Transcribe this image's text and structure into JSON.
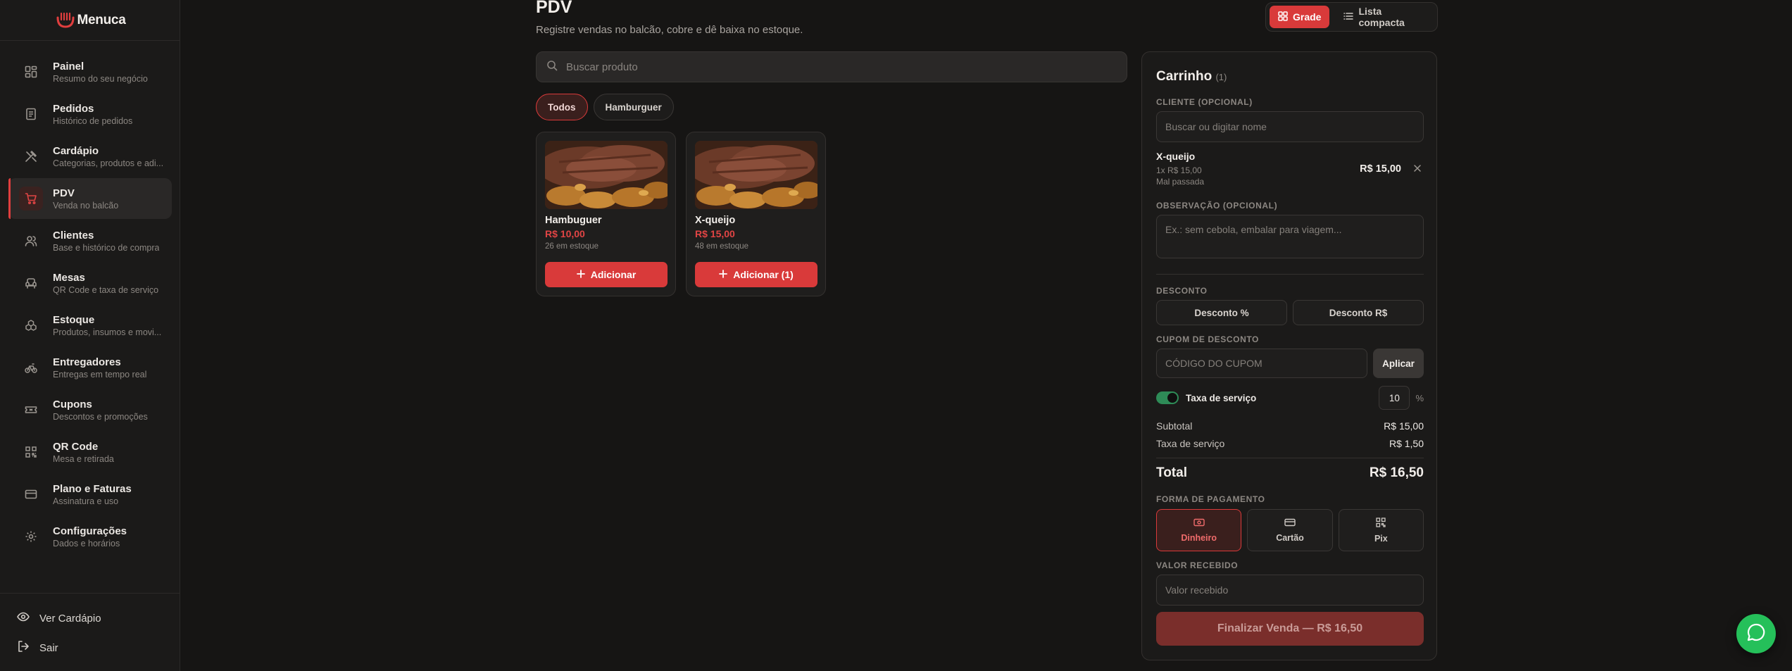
{
  "brand": {
    "name": "Menuca",
    "accent": "#d93a3a"
  },
  "sidebar": {
    "items": [
      {
        "label": "Painel",
        "sub": "Resumo do seu negócio",
        "icon": "dashboard-icon"
      },
      {
        "label": "Pedidos",
        "sub": "Histórico de pedidos",
        "icon": "receipt-icon"
      },
      {
        "label": "Cardápio",
        "sub": "Categorias, produtos e adi...",
        "icon": "utensils-icon"
      },
      {
        "label": "PDV",
        "sub": "Venda no balcão",
        "icon": "cart-icon",
        "active": true
      },
      {
        "label": "Clientes",
        "sub": "Base e histórico de compra",
        "icon": "users-icon"
      },
      {
        "label": "Mesas",
        "sub": "QR Code e taxa de serviço",
        "icon": "armchair-icon"
      },
      {
        "label": "Estoque",
        "sub": "Produtos, insumos e movi...",
        "icon": "boxes-icon"
      },
      {
        "label": "Entregadores",
        "sub": "Entregas em tempo real",
        "icon": "bike-icon"
      },
      {
        "label": "Cupons",
        "sub": "Descontos e promoções",
        "icon": "ticket-icon"
      },
      {
        "label": "QR Code",
        "sub": "Mesa e retirada",
        "icon": "qrcode-icon"
      },
      {
        "label": "Plano e Faturas",
        "sub": "Assinatura e uso",
        "icon": "credit-card-icon"
      },
      {
        "label": "Configurações",
        "sub": "Dados e horários",
        "icon": "gear-icon"
      }
    ],
    "footer": {
      "view_menu": "Ver Cardápio",
      "logout": "Sair"
    }
  },
  "header": {
    "title": "PDV",
    "subtitle": "Registre vendas no balcão, cobre e dê baixa no estoque.",
    "view_grid": "Grade",
    "view_list": "Lista compacta"
  },
  "search": {
    "placeholder": "Buscar produto"
  },
  "filters": [
    {
      "label": "Todos",
      "active": true
    },
    {
      "label": "Hamburguer",
      "active": false
    }
  ],
  "products": [
    {
      "name": "Hambuguer",
      "price": "R$ 10,00",
      "stock": "26 em estoque",
      "button": "Adicionar"
    },
    {
      "name": "X-queijo",
      "price": "R$ 15,00",
      "stock": "48 em estoque",
      "button": "Adicionar (1)"
    }
  ],
  "cart": {
    "title": "Carrinho",
    "count": "(1)",
    "client_label": "CLIENTE (OPCIONAL)",
    "client_placeholder": "Buscar ou digitar nome",
    "item": {
      "name": "X-queijo",
      "qty_price": "1x R$ 15,00",
      "note": "Mal passada",
      "total": "R$ 15,00"
    },
    "obs_label": "OBSERVAÇÃO (OPCIONAL)",
    "obs_placeholder": "Ex.: sem cebola, embalar para viagem...",
    "discount_label": "DESCONTO",
    "discount_percent": "Desconto %",
    "discount_value": "Desconto R$",
    "coupon_label": "CUPOM DE DESCONTO",
    "coupon_placeholder": "CÓDIGO DO CUPOM",
    "apply": "Aplicar",
    "service_label": "Taxa de serviço",
    "service_value": "10",
    "service_unit": "%",
    "subtotal_label": "Subtotal",
    "subtotal_value": "R$ 15,00",
    "service_fee_label": "Taxa de serviço",
    "service_fee_value": "R$ 1,50",
    "total_label": "Total",
    "total_value": "R$ 16,50",
    "payment_label": "FORMA DE PAGAMENTO",
    "payments": [
      "Dinheiro",
      "Cartão",
      "Pix"
    ],
    "received_label": "VALOR RECEBIDO",
    "received_placeholder": "Valor recebido",
    "finalize": "Finalizar Venda — R$ 16,50"
  }
}
